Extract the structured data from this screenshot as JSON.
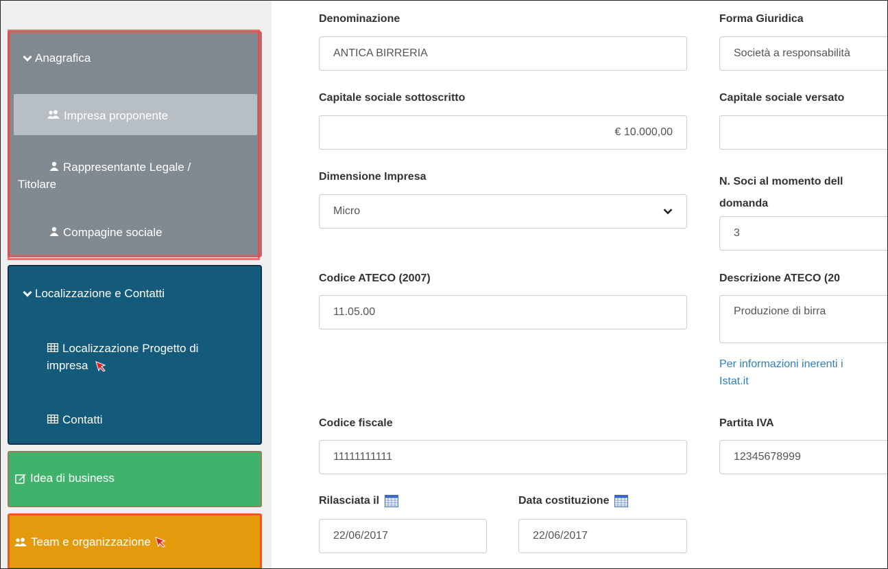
{
  "sidebar": {
    "anagrafica": {
      "title": "Anagrafica",
      "items": [
        {
          "label": "Impresa proponente",
          "icon": "users-icon",
          "active": true
        },
        {
          "label_line1": "Rappresentante Legale /",
          "label_line2": "Titolare",
          "icon": "user-icon"
        },
        {
          "label": "Compagine sociale",
          "icon": "user-icon"
        }
      ]
    },
    "localizzazione": {
      "title": "Localizzazione e Contatti",
      "items": [
        {
          "label_line1": "Localizzazione Progetto di",
          "label_line2": "impresa",
          "icon": "table-icon"
        },
        {
          "label": "Contatti",
          "icon": "table-icon"
        }
      ]
    },
    "idea": {
      "title": "Idea di business",
      "icon": "edit-icon"
    },
    "team": {
      "title": "Team e organizzazione",
      "icon": "users-icon"
    }
  },
  "form": {
    "denominazione": {
      "label": "Denominazione",
      "value": "ANTICA BIRRERIA"
    },
    "forma_giuridica": {
      "label": "Forma Giuridica",
      "value": "Società a responsabilità"
    },
    "capitale_sottoscritto": {
      "label": "Capitale sociale sottoscritto",
      "value": "€ 10.000,00"
    },
    "capitale_versato": {
      "label": "Capitale sociale versato",
      "value": ""
    },
    "dimensione": {
      "label": "Dimensione Impresa",
      "value": "Micro"
    },
    "n_soci": {
      "label_line1": "N. Soci al momento dell",
      "label_line2": "domanda",
      "value": "3"
    },
    "ateco": {
      "label": "Codice ATECO (2007)",
      "value": "11.05.00"
    },
    "descrizione_ateco": {
      "label": "Descrizione ATECO (20",
      "value": "Produzione di birra"
    },
    "info_link": {
      "line1": "Per informazioni inerenti i",
      "line2": "Istat.it"
    },
    "codice_fiscale": {
      "label": "Codice fiscale",
      "value": "11111111111"
    },
    "partita_iva": {
      "label": "Partita IVA",
      "value": "12345678999"
    },
    "rilasciata": {
      "label": "Rilasciata il",
      "value": "22/06/2017"
    },
    "data_costituzione": {
      "label": "Data costituzione",
      "value": "22/06/2017"
    }
  },
  "colors": {
    "anagrafica_bg": "#818a91",
    "localizzazione_bg": "#145a7a",
    "idea_bg": "#3fb36b",
    "team_bg": "#e39a0c",
    "link": "#2a7fc1"
  }
}
